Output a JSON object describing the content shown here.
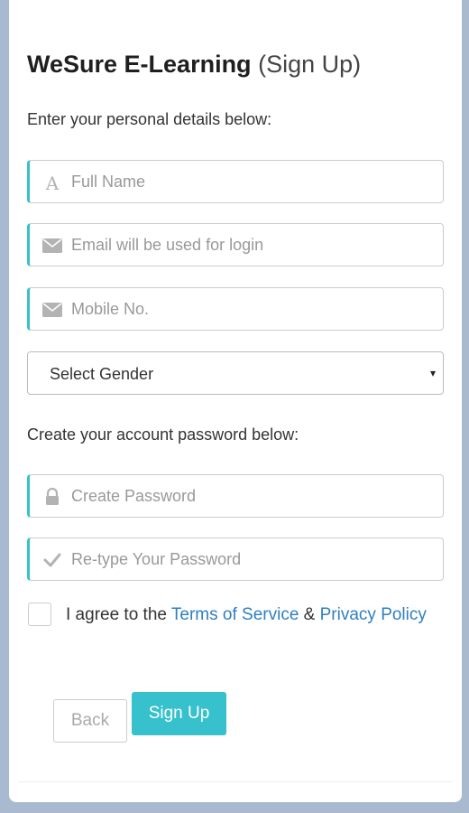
{
  "header": {
    "brand": "WeSure E-Learning",
    "subtitle": "(Sign Up)"
  },
  "personal_section": {
    "label": "Enter your personal details below:",
    "full_name": {
      "icon": "font-letter-icon",
      "placeholder": "Full Name",
      "value": ""
    },
    "email": {
      "icon": "envelope-icon",
      "placeholder": "Email will be used for login",
      "value": ""
    },
    "mobile": {
      "icon": "envelope-icon",
      "placeholder": "Mobile No.",
      "value": ""
    },
    "gender": {
      "selected": "Select Gender",
      "caret": "▾"
    }
  },
  "password_section": {
    "label": "Create your account password below:",
    "password": {
      "icon": "lock-icon",
      "placeholder": "Create Password",
      "value": ""
    },
    "retype": {
      "icon": "check-icon",
      "placeholder": "Re-type Your Password",
      "value": ""
    }
  },
  "agreement": {
    "checked": false,
    "prefix": "I agree to the ",
    "terms_link": "Terms of Service",
    "ampersand": " & ",
    "privacy_link": "Privacy Policy"
  },
  "buttons": {
    "back_label": "Back",
    "signup_label": "Sign Up"
  },
  "colors": {
    "accent": "#36c1cc",
    "link": "#2f7fbf",
    "page_background": "#a9b9cf"
  }
}
